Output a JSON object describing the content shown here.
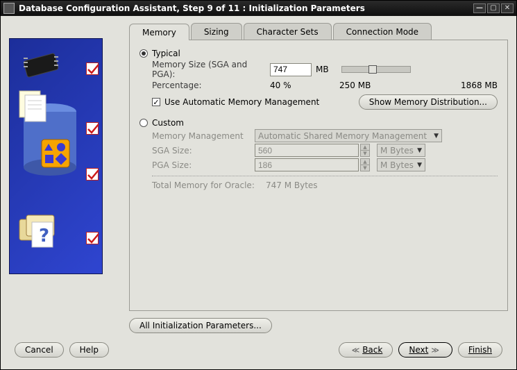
{
  "window": {
    "title": "Database Configuration Assistant, Step 9 of 11 : Initialization Parameters"
  },
  "tabs": {
    "memory": "Memory",
    "sizing": "Sizing",
    "charsets": "Character Sets",
    "connmode": "Connection Mode",
    "active": "memory"
  },
  "memory": {
    "typical": {
      "label": "Typical",
      "selected": true,
      "size_label": "Memory Size (SGA and PGA):",
      "size_value": "747",
      "size_unit": "MB",
      "percentage_label": "Percentage:",
      "percentage_value": "40 %",
      "slider_mid_label": "250 MB",
      "slider_max_label": "1868 MB",
      "use_auto_label": "Use Automatic Memory Management",
      "use_auto_checked": true,
      "show_dist_btn": "Show Memory Distribution..."
    },
    "custom": {
      "label": "Custom",
      "selected": false,
      "mgmt_label": "Memory Management",
      "mgmt_value": "Automatic Shared Memory Management",
      "sga_label": "SGA Size:",
      "sga_value": "560",
      "sga_unit": "M Bytes",
      "pga_label": "PGA Size:",
      "pga_value": "186",
      "pga_unit": "M Bytes",
      "total_label": "Total Memory for Oracle:",
      "total_value": "747 M Bytes"
    }
  },
  "all_params_btn": "All Initialization Parameters...",
  "footer": {
    "cancel": "Cancel",
    "help": "Help",
    "back": "Back",
    "next": "Next",
    "finish": "Finish"
  }
}
